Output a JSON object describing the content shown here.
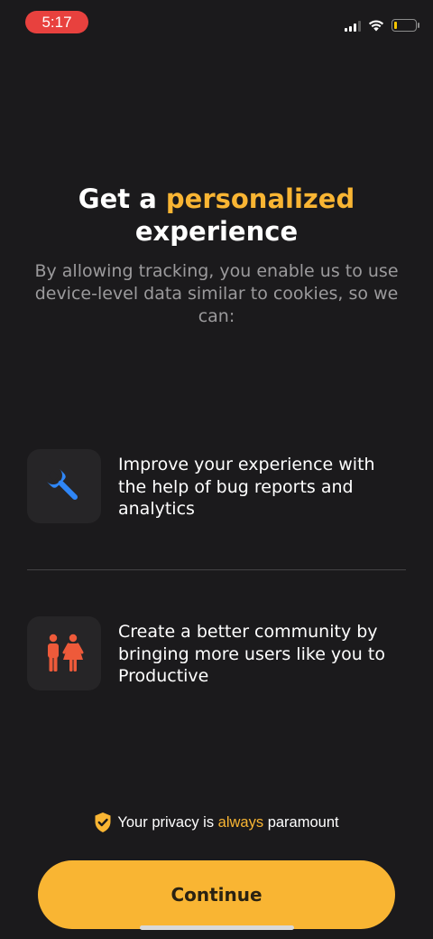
{
  "status_bar": {
    "time": "5:17",
    "colors": {
      "time_pill": "#e8413e",
      "battery_level": "#f5c400"
    }
  },
  "header": {
    "title_part1": "Get a",
    "title_accent": "personalized",
    "title_part2": "experience",
    "subtitle": "By allowing tracking, you enable us to use device-level data similar to cookies, so we can:"
  },
  "features": [
    {
      "icon": "wrench-icon",
      "text": "Improve your experience with the help of bug reports and analytics",
      "icon_color": "#2f86f6"
    },
    {
      "icon": "people-icon",
      "text": "Create a better community by bringing more users like you to Productive",
      "icon_color": "#ee5a3a"
    }
  ],
  "privacy": {
    "icon": "shield-check-icon",
    "text_before": "Your privacy is",
    "text_accent": "always",
    "text_after": "paramount"
  },
  "continue_button": {
    "label": "Continue"
  },
  "theme": {
    "background": "#1b1a1c",
    "accent": "#f9b533",
    "subtitle_color": "#9b9a9c"
  }
}
